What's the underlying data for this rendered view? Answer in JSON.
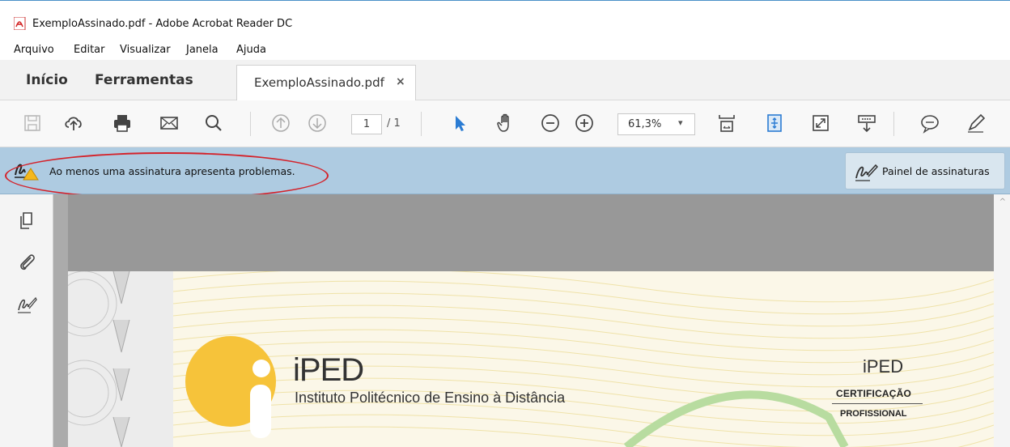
{
  "window": {
    "title": "ExemploAssinado.pdf - Adobe Acrobat Reader DC",
    "icon": "pdf-file-icon"
  },
  "menu": {
    "items": [
      "Arquivo",
      "Editar",
      "Visualizar",
      "Janela",
      "Ajuda"
    ]
  },
  "tabs": {
    "home": "Início",
    "tools": "Ferramentas",
    "document": "ExemploAssinado.pdf",
    "close_glyph": "×"
  },
  "toolbar": {
    "page_current": "1",
    "page_total": "/ 1",
    "zoom": "61,3%",
    "zoom_caret": "▾",
    "icons": [
      "save-icon",
      "cloud-upload-icon",
      "print-icon",
      "email-icon",
      "search-icon",
      "previous-page-icon",
      "next-page-icon",
      "select-cursor-icon",
      "hand-tool-icon",
      "zoom-out-icon",
      "zoom-in-icon",
      "fit-page-icon",
      "scroll-mode-icon",
      "full-screen-icon",
      "read-mode-icon",
      "comment-icon",
      "highlight-pen-icon"
    ]
  },
  "signature_bar": {
    "message": "Ao menos uma assinatura apresenta problemas.",
    "panel_button": "Painel de assinaturas",
    "highlight_color": "#d4222a"
  },
  "leftnav": {
    "icons": [
      "page-thumbnails-icon",
      "attachments-icon",
      "signatures-icon"
    ]
  },
  "document": {
    "logo_title": "iPED",
    "logo_subtitle": "Instituto Politécnico de Ensino à Distância",
    "right_title": "iPED",
    "right_line1": "CERTIFICAÇÃO",
    "right_line2": "PROFISSIONAL",
    "logo_color": "#f6c33a"
  },
  "colors": {
    "signature_bar_bg": "#aecbe1",
    "accent_blue": "#2b7cd3"
  }
}
